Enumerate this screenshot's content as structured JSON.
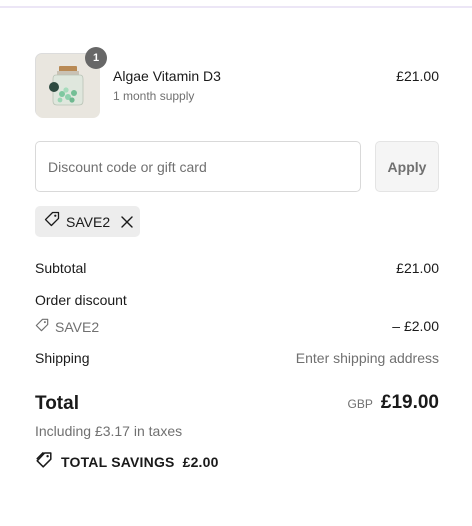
{
  "product": {
    "quantity": "1",
    "name": "Algae Vitamin D3",
    "variant": "1 month supply",
    "price": "£21.00"
  },
  "discount": {
    "placeholder": "Discount code or gift card",
    "apply_label": "Apply",
    "applied_code": "SAVE2"
  },
  "summary": {
    "subtotal_label": "Subtotal",
    "subtotal_value": "£21.00",
    "order_discount_label": "Order discount",
    "discount_code": "SAVE2",
    "discount_value": "– £2.00",
    "shipping_label": "Shipping",
    "shipping_value": "Enter shipping address",
    "total_label": "Total",
    "currency": "GBP",
    "total_value": "£19.00",
    "taxes_text": "Including £3.17 in taxes",
    "savings_label": "TOTAL SAVINGS",
    "savings_value": "£2.00"
  },
  "colors": {
    "text": "#1a1a1a",
    "muted": "#707070",
    "badge": "#676767",
    "chip_bg": "#ededed"
  },
  "icons": [
    "tag-icon",
    "close-icon",
    "tag-icon",
    "tags-icon"
  ]
}
